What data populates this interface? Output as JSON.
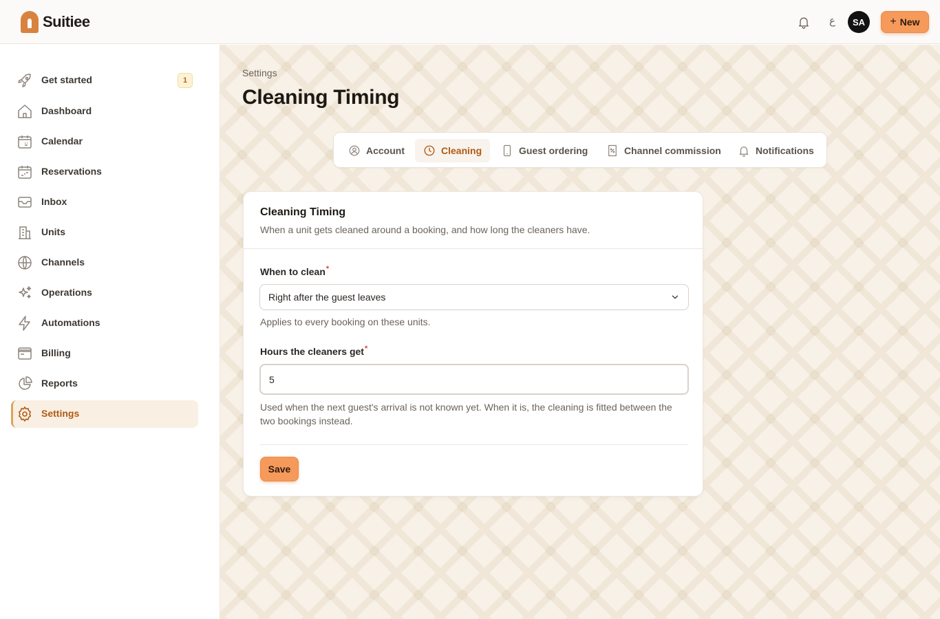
{
  "app": {
    "name": "Suitiee"
  },
  "topbar": {
    "lang_label": "ع",
    "avatar_initials": "SA",
    "new_label": "New",
    "new_plus": "+"
  },
  "sidebar": {
    "items": [
      {
        "label": "Get started",
        "icon": "rocket-icon",
        "badge": "1"
      },
      {
        "label": "Dashboard",
        "icon": "home-icon"
      },
      {
        "label": "Calendar",
        "icon": "calendar-icon"
      },
      {
        "label": "Reservations",
        "icon": "reservations-icon"
      },
      {
        "label": "Inbox",
        "icon": "inbox-icon"
      },
      {
        "label": "Units",
        "icon": "building-icon"
      },
      {
        "label": "Channels",
        "icon": "globe-icon"
      },
      {
        "label": "Operations",
        "icon": "sparkles-icon"
      },
      {
        "label": "Automations",
        "icon": "bolt-icon"
      },
      {
        "label": "Billing",
        "icon": "billing-icon"
      },
      {
        "label": "Reports",
        "icon": "pie-chart-icon"
      },
      {
        "label": "Settings",
        "icon": "gear-icon",
        "active": true
      }
    ]
  },
  "page": {
    "breadcrumb": "Settings",
    "title": "Cleaning Timing"
  },
  "tabs": [
    {
      "label": "Account",
      "icon": "user-circle-icon"
    },
    {
      "label": "Cleaning",
      "icon": "clock-icon",
      "active": true
    },
    {
      "label": "Guest ordering",
      "icon": "phone-icon"
    },
    {
      "label": "Channel commission",
      "icon": "percent-receipt-icon"
    },
    {
      "label": "Notifications",
      "icon": "bell-icon"
    }
  ],
  "card": {
    "title": "Cleaning Timing",
    "subtitle": "When a unit gets cleaned around a booking, and how long the cleaners have.",
    "when_label": "When to clean",
    "when_value": "Right after the guest leaves",
    "when_hint": "Applies to every booking on these units.",
    "hours_label": "Hours the cleaners get",
    "hours_value": "5",
    "hours_hint": "Used when the next guest's arrival is not known yet. When it is, the cleaning is fitted between the two bookings instead.",
    "required_mark": "*",
    "save_label": "Save"
  },
  "colors": {
    "accent": "#f59a5a",
    "active_text": "#b05a14",
    "background": "#f7f1e7"
  }
}
